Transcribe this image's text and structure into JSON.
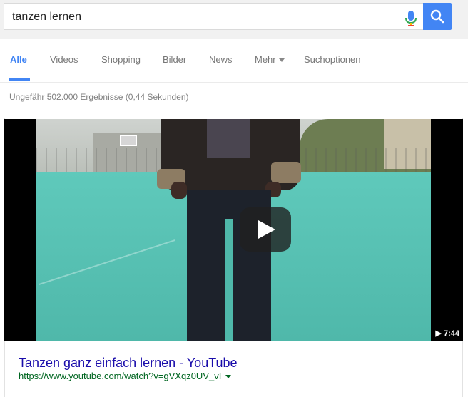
{
  "search": {
    "query": "tanzen lernen",
    "mic_icon": "microphone-icon",
    "submit_icon": "search-icon",
    "accent": "#4285f4"
  },
  "tabs": [
    {
      "label": "Alle",
      "active": true
    },
    {
      "label": "Videos"
    },
    {
      "label": "Shopping"
    },
    {
      "label": "Bilder"
    },
    {
      "label": "News"
    },
    {
      "label": "Mehr"
    },
    {
      "label": "Suchoptionen"
    }
  ],
  "stats": "Ungefähr 502.000 Ergebnisse (0,44 Sekunden)",
  "result": {
    "duration": "▶ 7:44",
    "title": "Tanzen ganz einfach lernen - YouTube",
    "url": "https://www.youtube.com/watch?v=gVXqz0UV_vI",
    "title_color": "#1a0dab",
    "url_color": "#006621"
  }
}
